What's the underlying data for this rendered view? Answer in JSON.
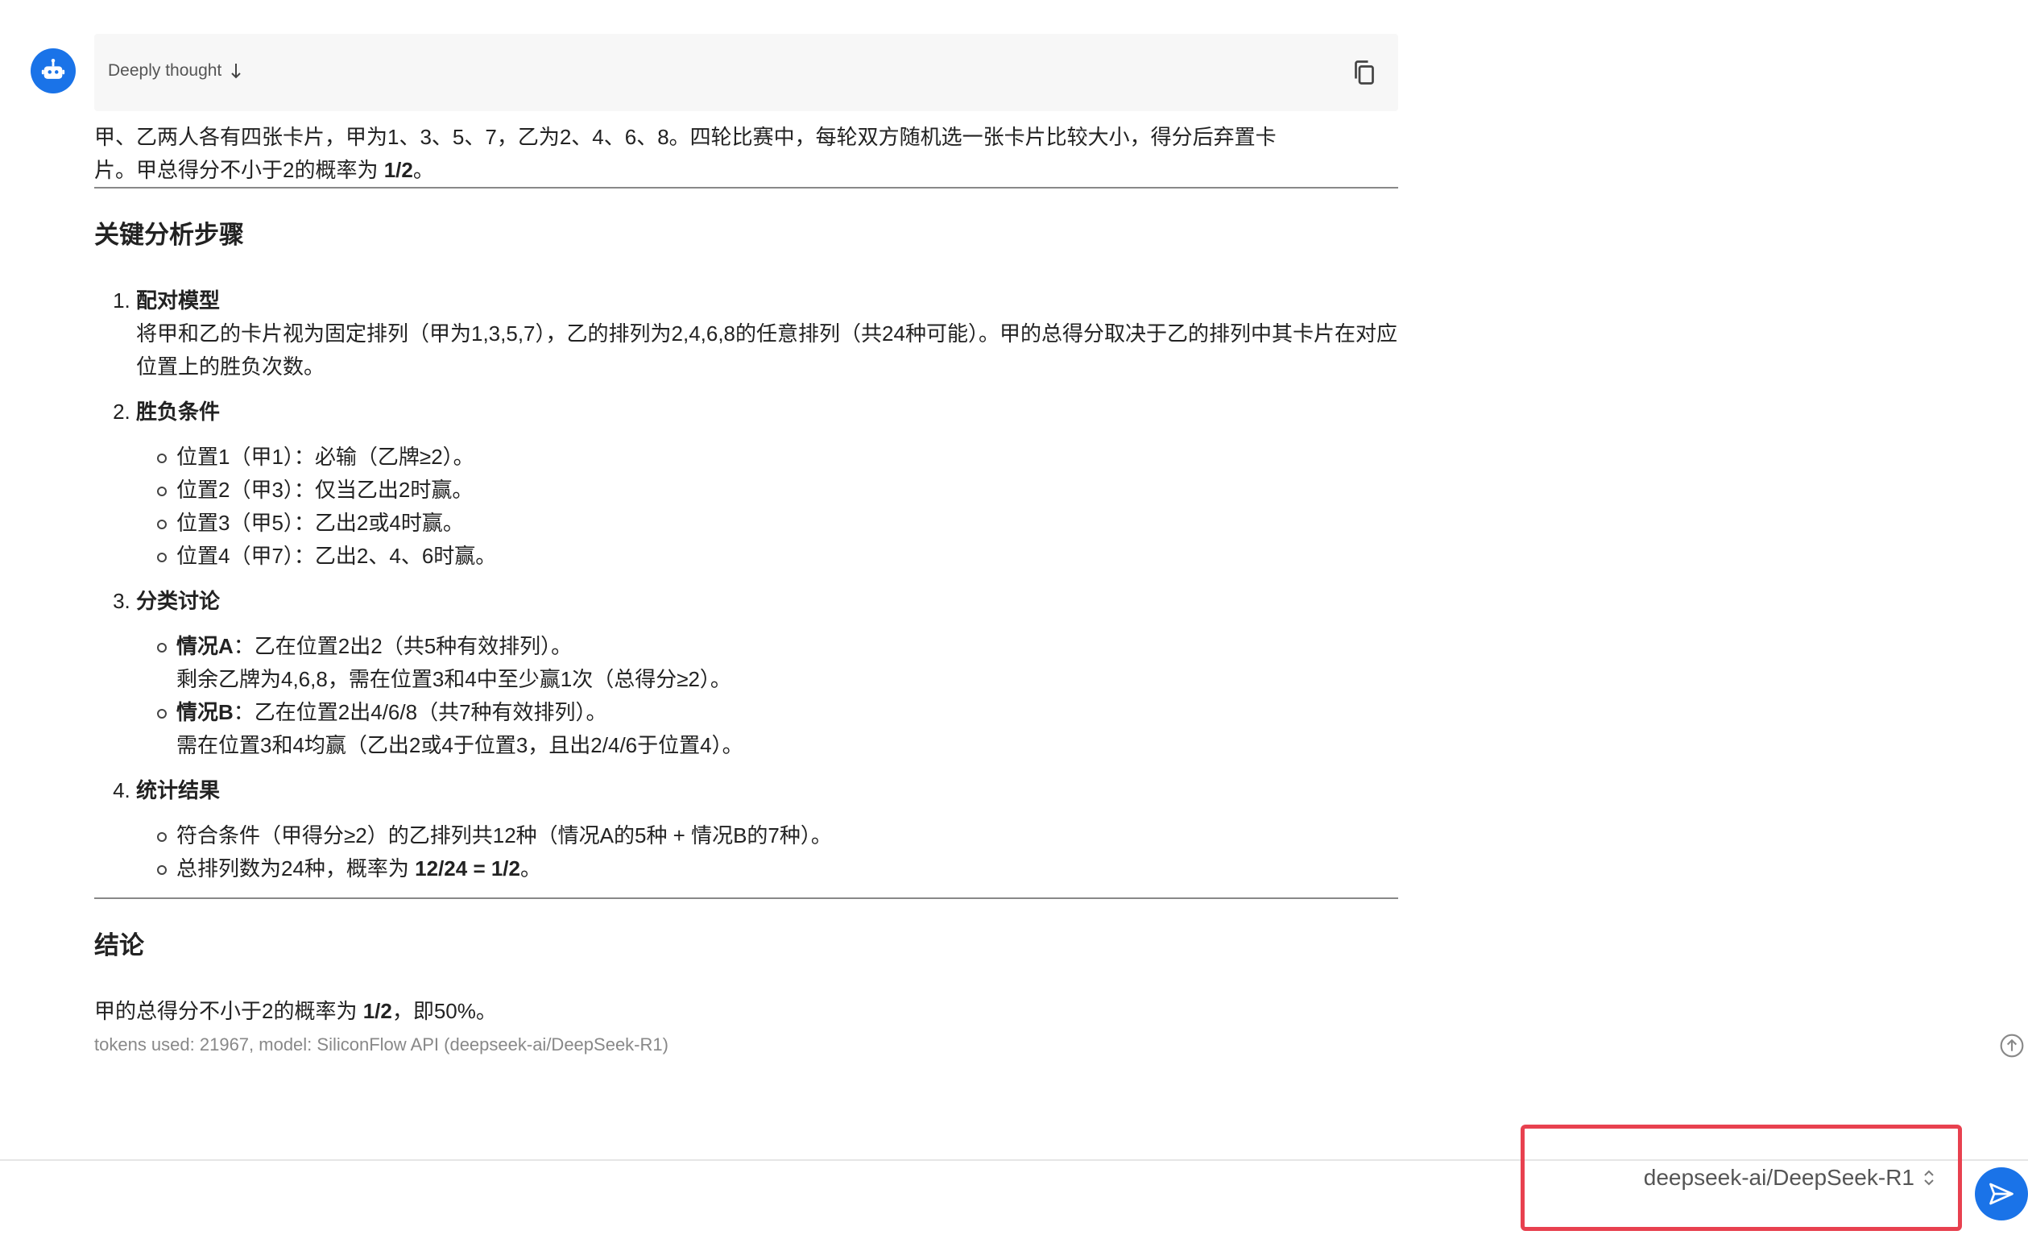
{
  "thought": {
    "label": "Deeply thought"
  },
  "intro": {
    "line1": "甲、乙两人各有四张卡片，甲为1、3、5、7，乙为2、4、6、8。四轮比赛中，每轮双方随机选一张卡片比较大小，得分后弃置卡",
    "line2_prefix": "片。甲总得分不小于2的概率为 ",
    "line2_bold": "1/2",
    "line2_suffix": "。"
  },
  "analysis": {
    "heading": "关键分析步骤",
    "steps": [
      {
        "title": "配对模型",
        "text": "将甲和乙的卡片视为固定排列（甲为1,3,5,7），乙的排列为2,4,6,8的任意排列（共24种可能）。甲的总得分取决于乙的排列中其卡片在对应位置上的胜负次数。"
      },
      {
        "title": "胜负条件",
        "items": [
          "位置1（甲1）：必输（乙牌≥2）。",
          "位置2（甲3）：仅当乙出2时赢。",
          "位置3（甲5）：乙出2或4时赢。",
          "位置4（甲7）：乙出2、4、6时赢。"
        ]
      },
      {
        "title": "分类讨论",
        "items": [
          {
            "bold": "情况A",
            "line1": "：乙在位置2出2（共5种有效排列）。",
            "line2": "剩余乙牌为4,6,8，需在位置3和4中至少赢1次（总得分≥2）。"
          },
          {
            "bold": "情况B",
            "line1": "：乙在位置2出4/6/8（共7种有效排列）。",
            "line2": "需在位置3和4均赢（乙出2或4于位置3，且出2/4/6于位置4）。"
          }
        ]
      },
      {
        "title": "统计结果",
        "items": [
          {
            "text": "符合条件（甲得分≥2）的乙排列共12种（情况A的5种 + 情况B的7种）。"
          },
          {
            "prefix": "总排列数为24种，概率为 ",
            "bold": "12/24 = 1/2",
            "suffix": "。"
          }
        ]
      }
    ]
  },
  "conclusion": {
    "heading": "结论",
    "prefix": "甲的总得分不小于2的概率为 ",
    "bold": "1/2",
    "suffix": "，即50%。"
  },
  "footnote": "tokens used: 21967, model: SiliconFlow API (deepseek-ai/DeepSeek-R1)",
  "composer": {
    "model_value": "deepseek-ai/DeepSeek-R1"
  },
  "colors": {
    "accent": "#1a73e8",
    "highlight_border": "#e8414f"
  },
  "icons": [
    "robot-icon",
    "arrow-down-icon",
    "copy-icon",
    "scroll-up-icon",
    "chevron-updown-icon",
    "send-icon"
  ]
}
